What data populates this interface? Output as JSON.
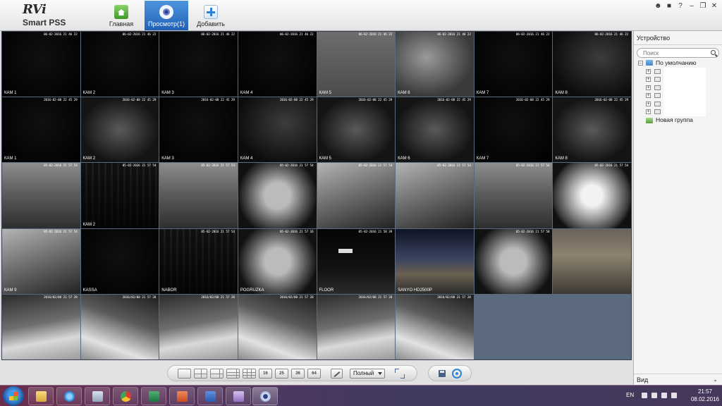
{
  "app": {
    "brand": "RVi",
    "product": "Smart PSS"
  },
  "nav": {
    "home": "Главная",
    "preview": "Просмотр(1)",
    "add": "Добавить"
  },
  "window_controls": [
    "user",
    "lock",
    "help",
    "minimize",
    "restore",
    "close"
  ],
  "tiles": [
    {
      "ts": "06-02-2016 21 46 22",
      "cam": "КАМ 1",
      "style": "s-dark"
    },
    {
      "ts": "06-02-2016 21 46 22",
      "cam": "КАМ 2",
      "style": "s-dark"
    },
    {
      "ts": "06-02-2016 21 46 22",
      "cam": "КАМ 3",
      "style": "s-dark"
    },
    {
      "ts": "06-02-2016 21 46 22",
      "cam": "КАМ 4",
      "style": "s-dark"
    },
    {
      "ts": "06-02-2016 21 46 22",
      "cam": "КАМ 5",
      "style": "s-grey"
    },
    {
      "ts": "06-02-2016 21 46 22",
      "cam": "КАМ 6",
      "style": "s-grey2"
    },
    {
      "ts": "06-02-2016 21 46 22",
      "cam": "КАМ 7",
      "style": "s-dark"
    },
    {
      "ts": "06-02-2016 21 46 22",
      "cam": "КАМ 8",
      "style": "s-night"
    },
    {
      "ts": "2016-02-08 22 45 29",
      "cam": "КАМ 1",
      "style": "s-dark"
    },
    {
      "ts": "2016-02-08 22 45 29",
      "cam": "КАМ 2",
      "style": "s-night2"
    },
    {
      "ts": "2016-02-08 22 45 29",
      "cam": "КАМ 3",
      "style": "s-dark"
    },
    {
      "ts": "2016-02-08 22 45 29",
      "cam": "КАМ 4",
      "style": "s-night"
    },
    {
      "ts": "2016-02-08 22 45 29",
      "cam": "КАМ 5",
      "style": "s-night2"
    },
    {
      "ts": "2016-02-08 22 45 29",
      "cam": "КАМ 6",
      "style": "s-night2"
    },
    {
      "ts": "2016-02-08 22 45 29",
      "cam": "КАМ 7",
      "style": "s-dark"
    },
    {
      "ts": "2016-02-08 22 45 29",
      "cam": "КАМ 8",
      "style": "s-night2"
    },
    {
      "ts": "05-02-2016 21 57 54",
      "cam": "",
      "style": "s-room"
    },
    {
      "ts": "05-02-2016 21 57 54",
      "cam": "КАМ 2",
      "style": "s-ware"
    },
    {
      "ts": "05-02-2016 21 57 54",
      "cam": "",
      "style": "s-room"
    },
    {
      "ts": "05-02-2016 21 57 54",
      "cam": "",
      "style": "s-fish2"
    },
    {
      "ts": "05-02-2016 21 57 54",
      "cam": "",
      "style": "s-room2"
    },
    {
      "ts": "05-02-2016 21 57 54",
      "cam": "",
      "style": "s-room2"
    },
    {
      "ts": "05-02-2016 21 57 54",
      "cam": "",
      "style": "s-room"
    },
    {
      "ts": "05-02-2016 21 57 54",
      "cam": "",
      "style": "s-fish"
    },
    {
      "ts": "05-02-2016 21 57 54",
      "cam": "КАМ 9",
      "style": "s-room2"
    },
    {
      "ts": "",
      "cam": "KASSA",
      "style": "s-dark"
    },
    {
      "ts": "05-02-2016 21 57 54",
      "cam": "NABOR",
      "style": "s-ware"
    },
    {
      "ts": "05-02-2016 21 57 16",
      "cam": "POGRUZKA",
      "style": "s-fish2"
    },
    {
      "ts": "05-02-2016 21 58 39",
      "cam": "FLOOR",
      "style": "s-floor"
    },
    {
      "ts": "",
      "cam": "SANYO HD2500P",
      "style": "s-city"
    },
    {
      "ts": "05-02-2016 21 57 58",
      "cam": "",
      "style": "s-fish2"
    },
    {
      "ts": "",
      "cam": "",
      "style": "s-yard"
    },
    {
      "ts": "2016/02/08 21 57 28",
      "cam": "",
      "style": "s-snow"
    },
    {
      "ts": "2016/02/08 21 57 28",
      "cam": "",
      "style": "s-snow2"
    },
    {
      "ts": "2016/02/08 21 57 28",
      "cam": "",
      "style": "s-snow"
    },
    {
      "ts": "2016/02/08 21 57 28",
      "cam": "",
      "style": "s-snow2"
    },
    {
      "ts": "2016/02/08 21 57 28",
      "cam": "",
      "style": "s-snow"
    },
    {
      "ts": "2016/02/08 21 57 28",
      "cam": "",
      "style": "s-snow2"
    },
    {
      "ts": "",
      "cam": "",
      "style": "empty"
    },
    {
      "ts": "",
      "cam": "",
      "style": "empty"
    }
  ],
  "panel": {
    "title": "Устройство",
    "search_placeholder": "Поиск",
    "root": "По умолчанию",
    "device_count": 6,
    "new_group": "Новая группа",
    "footer": "Вид"
  },
  "toolbar": {
    "layouts": [
      {
        "label": "",
        "cls": "g1"
      },
      {
        "label": "",
        "cls": "g4"
      },
      {
        "label": "",
        "cls": "g6"
      },
      {
        "label": "",
        "cls": "g8"
      },
      {
        "label": "",
        "cls": "g9"
      },
      {
        "label": "16",
        "cls": "gn"
      },
      {
        "label": "25",
        "cls": "gn"
      },
      {
        "label": "36",
        "cls": "gn"
      },
      {
        "label": "64",
        "cls": "gn"
      }
    ],
    "mode": "Полный"
  },
  "taskbar": {
    "apps": [
      "explorer",
      "ie",
      "calc",
      "chrome",
      "excel",
      "powerpoint",
      "word",
      "notes",
      "pss"
    ],
    "lang": "EN",
    "time": "21:57",
    "date": "08.02.2016"
  }
}
